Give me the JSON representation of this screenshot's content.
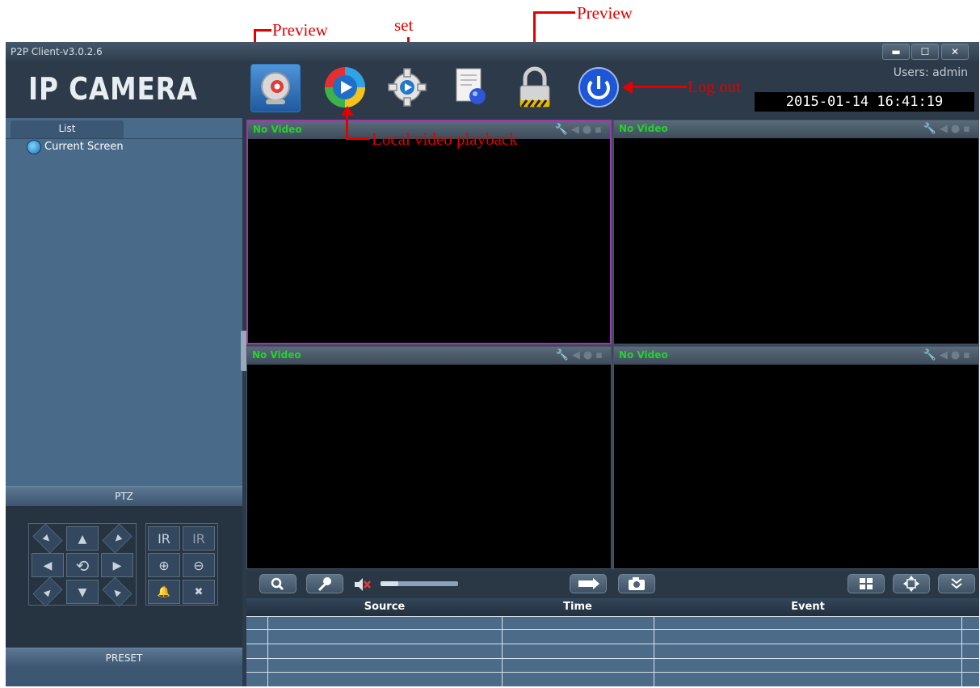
{
  "annotations": {
    "preview_top_left": "Preview",
    "set": "set",
    "preview_top_right": "Preview",
    "log_out": "Log out",
    "local_playback": "Local video playback"
  },
  "window": {
    "title": "P2P Client-v3.0.2.6",
    "minimize": "▬",
    "maximize": "☐",
    "close": "✕"
  },
  "header": {
    "logo": "IP CAMERA",
    "users": "Users: admin",
    "datetime": "2015-01-14 16:41:19"
  },
  "sidebar": {
    "tab": "List",
    "tree_item": "Current Screen",
    "ptz_label": "PTZ",
    "preset_label": "PRESET",
    "ptz_buttons": [
      "▶",
      "▲",
      "◀",
      "IR",
      "IR",
      "◀",
      "⟲",
      "▶",
      "⊕",
      "⊖",
      "▶",
      "▼",
      "◀",
      "🔔",
      "✖"
    ]
  },
  "video": {
    "panes": [
      {
        "label": "No Video"
      },
      {
        "label": "No Video"
      },
      {
        "label": "No Video"
      },
      {
        "label": "No Video"
      }
    ],
    "pane_icons": "🔧◀●▪"
  },
  "controls": {
    "volume_level": 0.23
  },
  "events": {
    "columns": [
      "Source",
      "Time",
      "Event"
    ]
  }
}
